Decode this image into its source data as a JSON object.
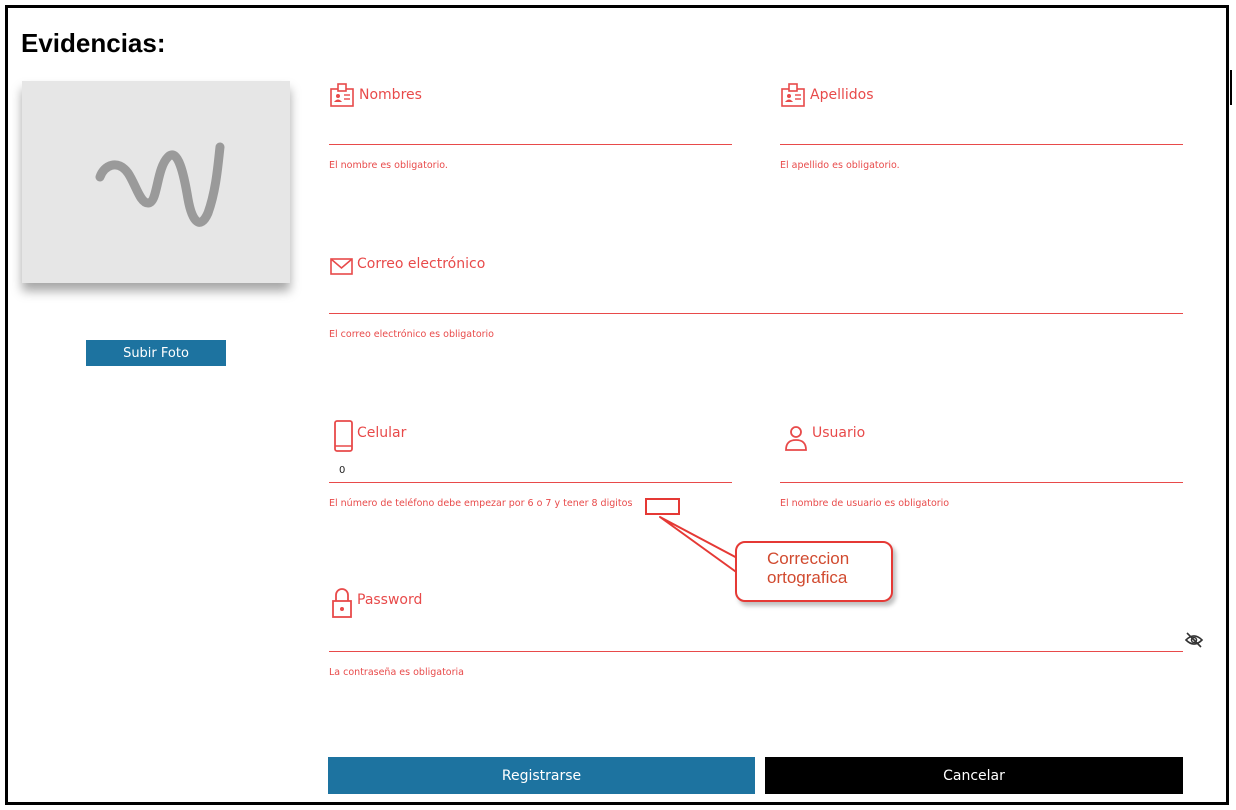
{
  "page": {
    "title": "Evidencias:"
  },
  "photo": {
    "placeholder_icon": "wave-logo-icon",
    "upload_label": "Subir Foto"
  },
  "form": {
    "nombres": {
      "label": "Nombres",
      "icon": "id-card-icon",
      "value": "",
      "error": "El nombre es obligatorio."
    },
    "apellidos": {
      "label": "Apellidos",
      "icon": "id-card-icon",
      "value": "",
      "error": "El apellido es obligatorio."
    },
    "correo": {
      "label": "Correo electrónico",
      "icon": "envelope-icon",
      "value": "",
      "error": "El correo electrónico es obligatorio"
    },
    "celular": {
      "label": "Celular",
      "icon": "phone-icon",
      "value": "0",
      "error": "El número de teléfono debe empezar por 6 o 7 y tener 8 digitos"
    },
    "usuario": {
      "label": "Usuario",
      "icon": "user-icon",
      "value": "",
      "error": "El nombre de usuario es obligatorio"
    },
    "password": {
      "label": "Password",
      "icon": "lock-icon",
      "value": "",
      "error": "La contraseña es obligatoria",
      "toggle_icon": "eye-slash-icon"
    }
  },
  "annotation": {
    "callout_line1": "Correccion",
    "callout_line2": "ortografica"
  },
  "actions": {
    "register_label": "Registrarse",
    "cancel_label": "Cancelar"
  },
  "colors": {
    "error_red": "#e84a4a",
    "primary_blue": "#1d73a0",
    "annotation_red": "#e53935"
  }
}
